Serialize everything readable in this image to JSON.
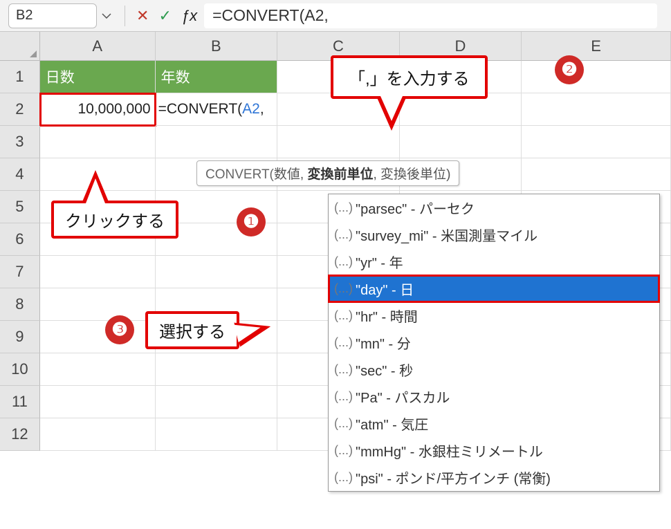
{
  "name_box": "B2",
  "formula_bar": "=CONVERT(A2,",
  "columns": [
    "A",
    "B",
    "C",
    "D",
    "E"
  ],
  "rows": [
    "1",
    "2",
    "3",
    "4",
    "5",
    "6",
    "7",
    "8",
    "9",
    "10",
    "11",
    "12"
  ],
  "headers": {
    "A1": "日数",
    "B1": "年数"
  },
  "A2": "10,000,000",
  "B2_edit": {
    "prefix": "=CONVERT(",
    "ref": "A2",
    "suffix": ","
  },
  "tooltip": {
    "fn": "CONVERT(",
    "arg1": "数値",
    "argBold": "変換前単位",
    "arg3": "変換後単位",
    "close": ")"
  },
  "dropdown": [
    {
      "icon": "(...)",
      "label": "\"parsec\" - パーセク",
      "selected": false
    },
    {
      "icon": "(...)",
      "label": "\"survey_mi\" - 米国測量マイル",
      "selected": false
    },
    {
      "icon": "(...)",
      "label": "\"yr\" - 年",
      "selected": false
    },
    {
      "icon": "(...)",
      "label": "\"day\" - 日",
      "selected": true
    },
    {
      "icon": "(...)",
      "label": "\"hr\" - 時間",
      "selected": false
    },
    {
      "icon": "(...)",
      "label": "\"mn\" - 分",
      "selected": false
    },
    {
      "icon": "(...)",
      "label": "\"sec\" - 秒",
      "selected": false
    },
    {
      "icon": "(...)",
      "label": "\"Pa\" - パスカル",
      "selected": false
    },
    {
      "icon": "(...)",
      "label": "\"atm\" - 気圧",
      "selected": false
    },
    {
      "icon": "(...)",
      "label": "\"mmHg\" - 水銀柱ミリメートル",
      "selected": false
    },
    {
      "icon": "(...)",
      "label": "\"psi\" - ポンド/平方インチ (常衡)",
      "selected": false
    }
  ],
  "callouts": {
    "c1": "クリックする",
    "c2": "「,」を入力する",
    "c3": "選択する"
  },
  "badges": {
    "b1": "❶",
    "b2": "❷",
    "b3": "❸"
  }
}
